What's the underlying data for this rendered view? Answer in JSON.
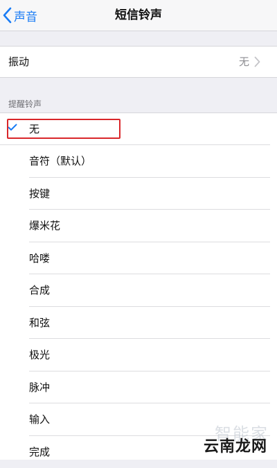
{
  "navbar": {
    "back_label": "声音",
    "title": "短信铃声"
  },
  "vibration": {
    "label": "振动",
    "value": "无"
  },
  "alert_tones": {
    "header": "提醒铃声",
    "selected_index": 0,
    "items": [
      "无",
      "音符（默认）",
      "按键",
      "爆米花",
      "哈喽",
      "合成",
      "和弦",
      "极光",
      "脉冲",
      "输入",
      "完成"
    ]
  },
  "watermark": {
    "top": "智能家",
    "bottom": "云南龙网"
  },
  "colors": {
    "accent": "#1a7cf5",
    "highlight_box": "#d9262a",
    "background": "#efeff4"
  }
}
